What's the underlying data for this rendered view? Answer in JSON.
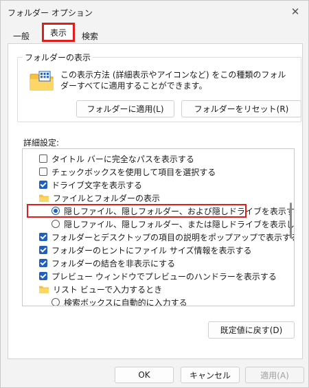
{
  "window": {
    "title": "フォルダー オプション"
  },
  "tabs": [
    {
      "label": "一般"
    },
    {
      "label": "表示"
    },
    {
      "label": "検索"
    }
  ],
  "folder_views": {
    "label": "フォルダーの表示",
    "description": "この表示方法 (詳細表示やアイコンなど) をこの種類のフォルダーすべてに適用することができます。",
    "apply_label": "フォルダーに適用(L)",
    "reset_label": "フォルダーをリセット(R)"
  },
  "advanced": {
    "label": "詳細設定:",
    "items": [
      {
        "type": "checkbox",
        "checked": false,
        "label": "タイトル バーに完全なパスを表示する"
      },
      {
        "type": "checkbox",
        "checked": false,
        "label": "チェックボックスを使用して項目を選択する"
      },
      {
        "type": "checkbox",
        "checked": true,
        "label": "ドライブ文字を表示する"
      },
      {
        "type": "folder",
        "label": "ファイルとフォルダーの表示"
      },
      {
        "type": "radio",
        "checked": true,
        "label": "隠しファイル、隠しフォルダー、および隠しドライブを表示する"
      },
      {
        "type": "radio",
        "checked": false,
        "label": "隠しファイル、隠しフォルダー、または隠しドライブを表示しない"
      },
      {
        "type": "checkbox",
        "checked": true,
        "label": "フォルダーとデスクトップの項目の説明をポップアップで表示する"
      },
      {
        "type": "checkbox",
        "checked": true,
        "label": "フォルダーのヒントにファイル サイズ情報を表示する"
      },
      {
        "type": "checkbox",
        "checked": true,
        "label": "フォルダーの結合を非表示にする"
      },
      {
        "type": "checkbox",
        "checked": true,
        "label": "プレビュー ウィンドウでプレビューのハンドラーを表示する"
      },
      {
        "type": "folder",
        "label": "リスト ビューで入力するとき"
      },
      {
        "type": "radio",
        "checked": false,
        "label": "検索ボックスに自動的に入力する"
      }
    ],
    "restore_label": "既定値に戻す(D)"
  },
  "footer": {
    "ok_label": "OK",
    "cancel_label": "キャンセル",
    "apply_label": "適用(A)"
  },
  "colors": {
    "accent": "#1f5fbf",
    "highlight": "#e21b1b"
  }
}
